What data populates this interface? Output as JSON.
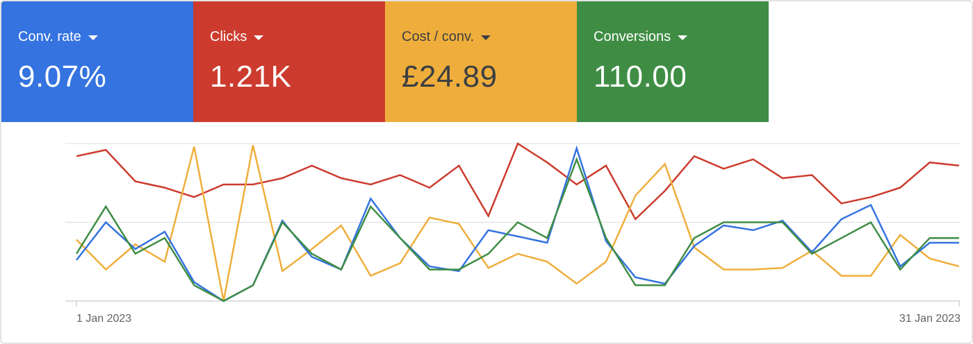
{
  "metric_tiles": [
    {
      "label": "Conv. rate",
      "value": "9.07%",
      "color": "#3473e0",
      "text_color": "#ffffff"
    },
    {
      "label": "Clicks",
      "value": "1.21K",
      "color": "#cc3b2e",
      "text_color": "#ffffff"
    },
    {
      "label": "Cost / conv.",
      "value": "£24.89",
      "color": "#efae3b",
      "text_color": "#3c3f43"
    },
    {
      "label": "Conversions",
      "value": "110.00",
      "color": "#3f8d44",
      "text_color": "#ffffff"
    }
  ],
  "chart_data": {
    "type": "line",
    "x": [
      "1 Jan 2023",
      "2 Jan 2023",
      "3 Jan 2023",
      "4 Jan 2023",
      "5 Jan 2023",
      "6 Jan 2023",
      "7 Jan 2023",
      "8 Jan 2023",
      "9 Jan 2023",
      "10 Jan 2023",
      "11 Jan 2023",
      "12 Jan 2023",
      "13 Jan 2023",
      "14 Jan 2023",
      "15 Jan 2023",
      "16 Jan 2023",
      "17 Jan 2023",
      "18 Jan 2023",
      "19 Jan 2023",
      "20 Jan 2023",
      "21 Jan 2023",
      "22 Jan 2023",
      "23 Jan 2023",
      "24 Jan 2023",
      "25 Jan 2023",
      "26 Jan 2023",
      "27 Jan 2023",
      "28 Jan 2023",
      "29 Jan 2023",
      "30 Jan 2023",
      "31 Jan 2023"
    ],
    "x_tick_labels": [
      "1 Jan 2023",
      "31 Jan 2023"
    ],
    "ylim": [
      0,
      1
    ],
    "grid": true,
    "series": [
      {
        "color": "#cc3b2e",
        "values": [
          0.92,
          0.96,
          0.76,
          0.72,
          0.66,
          0.74,
          0.74,
          0.78,
          0.86,
          0.78,
          0.74,
          0.8,
          0.72,
          0.86,
          0.54,
          1.0,
          0.88,
          0.74,
          0.86,
          0.52,
          0.7,
          0.92,
          0.84,
          0.9,
          0.78,
          0.8,
          0.62,
          0.66,
          0.72,
          0.88,
          0.86
        ]
      },
      {
        "color": "#efae3b",
        "values": [
          0.39,
          0.2,
          0.36,
          0.25,
          0.98,
          0.0,
          0.99,
          0.19,
          0.33,
          0.48,
          0.16,
          0.24,
          0.53,
          0.49,
          0.21,
          0.3,
          0.25,
          0.11,
          0.25,
          0.67,
          0.87,
          0.34,
          0.2,
          0.2,
          0.21,
          0.32,
          0.16,
          0.16,
          0.42,
          0.27,
          0.22
        ]
      },
      {
        "color": "#3473e0",
        "values": [
          0.26,
          0.5,
          0.33,
          0.44,
          0.12,
          0.0,
          0.1,
          0.51,
          0.28,
          0.2,
          0.65,
          0.4,
          0.22,
          0.19,
          0.45,
          0.41,
          0.37,
          0.97,
          0.38,
          0.15,
          0.11,
          0.35,
          0.48,
          0.45,
          0.51,
          0.31,
          0.52,
          0.61,
          0.22,
          0.37,
          0.37
        ]
      },
      {
        "color": "#3f8d44",
        "values": [
          0.3,
          0.6,
          0.3,
          0.4,
          0.1,
          0.0,
          0.1,
          0.5,
          0.3,
          0.2,
          0.6,
          0.4,
          0.2,
          0.2,
          0.3,
          0.5,
          0.4,
          0.9,
          0.4,
          0.1,
          0.1,
          0.4,
          0.5,
          0.5,
          0.5,
          0.3,
          0.4,
          0.5,
          0.2,
          0.4,
          0.4
        ]
      }
    ]
  }
}
